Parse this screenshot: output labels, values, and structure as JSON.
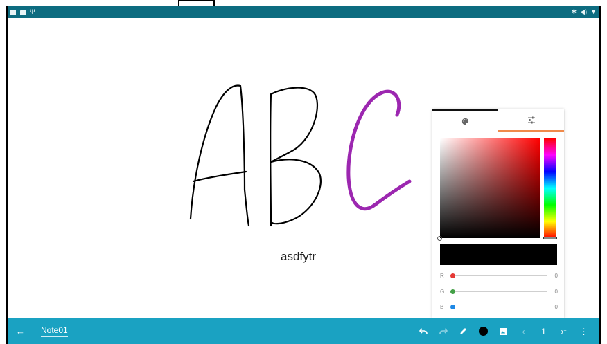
{
  "status_bar": {
    "left_icons": [
      "image-icon",
      "sd-card-icon",
      "usb-icon"
    ],
    "right_icons": [
      "bluetooth-icon",
      "volume-icon",
      "wifi-icon"
    ]
  },
  "canvas": {
    "handwriting": [
      "A",
      "B",
      "C"
    ],
    "handwriting_colors": [
      "#000000",
      "#000000",
      "#9c27b0"
    ],
    "typed_text": "asdfytr"
  },
  "color_picker": {
    "tabs": [
      {
        "icon": "palette-icon"
      },
      {
        "icon": "sliders-icon"
      }
    ],
    "active_tab": 1,
    "hue_color": "#ff0000",
    "selected_color": "#000000",
    "sliders": [
      {
        "label": "R",
        "value": "0",
        "color": "#e53935"
      },
      {
        "label": "G",
        "value": "0",
        "color": "#43a047"
      },
      {
        "label": "B",
        "value": "0",
        "color": "#1e88e5"
      }
    ]
  },
  "toolbar": {
    "back_icon": "arrow-back-icon",
    "title": "Note01",
    "page_number": "1",
    "pen_color": "#000000",
    "buttons": [
      "undo-icon",
      "redo-icon",
      "pen-icon",
      "color-icon",
      "image-icon",
      "prev-page-icon",
      "next-page-icon",
      "more-icon"
    ],
    "accent": "#1aa2c2"
  }
}
